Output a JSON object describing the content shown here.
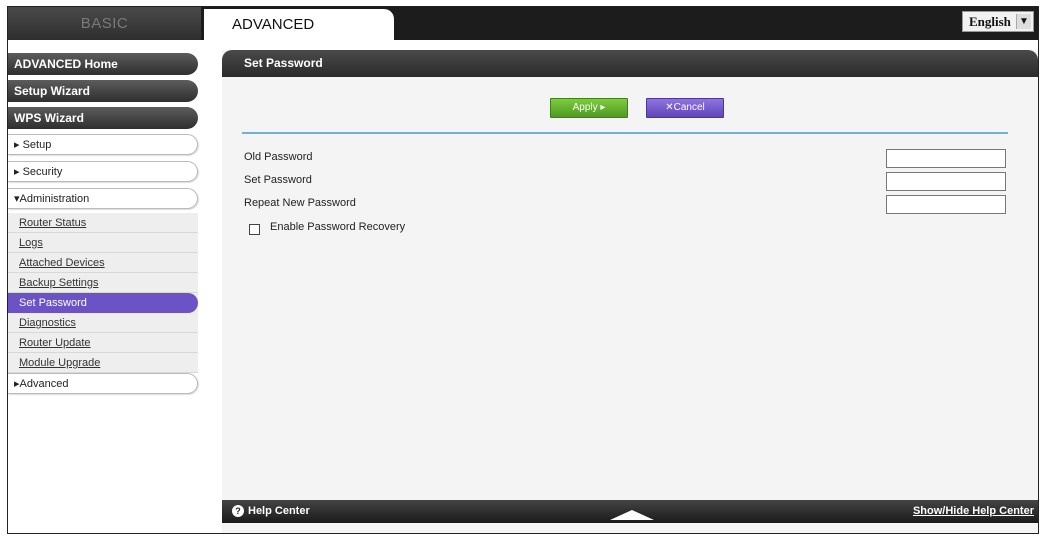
{
  "header": {
    "tab_basic": "BASIC",
    "tab_advanced": "ADVANCED",
    "language": "English"
  },
  "sidebar": {
    "home": "ADVANCED Home",
    "setup_wizard": "Setup Wizard",
    "wps_wizard": "WPS Wizard",
    "setup": "▸ Setup",
    "security": "▸ Security",
    "administration": "▾Administration",
    "admin_items": [
      "Router Status",
      "Logs",
      "Attached Devices",
      "Backup Settings",
      "Set Password",
      "Diagnostics",
      "Router Update",
      "Module Upgrade"
    ],
    "advanced": "▸Advanced"
  },
  "panel": {
    "title": "Set Password",
    "apply_label": "Apply ▸",
    "cancel_label": "✕Cancel",
    "old_password_label": "Old Password",
    "set_password_label": "Set Password",
    "repeat_password_label": "Repeat New Password",
    "enable_recovery_label": "Enable Password Recovery"
  },
  "help": {
    "label": "Help Center",
    "toggle": "Show/Hide Help Center"
  },
  "colors": {
    "active_item": "#6b53c6",
    "apply_button": "#5ea82c",
    "cancel_button": "#7258cc",
    "divider": "#6fb2d8"
  }
}
